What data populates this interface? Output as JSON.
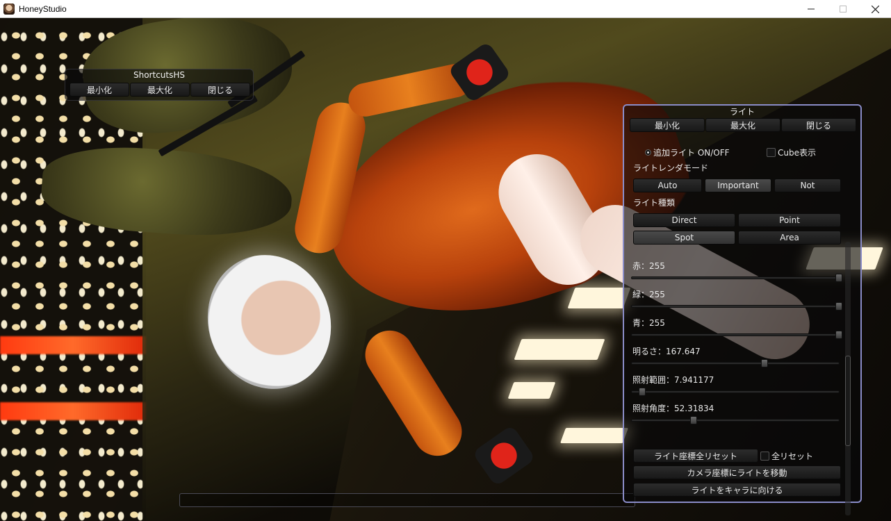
{
  "window": {
    "title": "HoneyStudio",
    "minimize_glyph": "—",
    "close_glyph": "✕"
  },
  "shortcuts_panel": {
    "title": "ShortcutsHS",
    "buttons": {
      "minimize": "最小化",
      "maximize": "最大化",
      "close": "閉じる"
    }
  },
  "light_panel": {
    "title": "ライト",
    "buttons": {
      "minimize": "最小化",
      "maximize": "最大化",
      "close": "閉じる"
    },
    "add_light_toggle": {
      "label": "追加ライト ON/OFF",
      "checked": true
    },
    "cube_toggle": {
      "label": "Cube表示",
      "checked": false
    },
    "render_mode": {
      "label": "ライトレンダモード",
      "options": [
        "Auto",
        "Important",
        "Not"
      ],
      "selected": "Important"
    },
    "light_type": {
      "label": "ライト種類",
      "options": [
        "Direct",
        "Point",
        "Spot",
        "Area"
      ],
      "selected": "Spot"
    },
    "sliders": {
      "red": {
        "label": "赤：255",
        "value": 255,
        "min": 0,
        "max": 255
      },
      "green": {
        "label": "緑：255",
        "value": 255,
        "min": 0,
        "max": 255
      },
      "blue": {
        "label": "青：255",
        "value": 255,
        "min": 0,
        "max": 255
      },
      "brightness": {
        "label": "明るさ：167.647",
        "value": 0.64
      },
      "range": {
        "label": "照射範囲：7.941177",
        "value": 0.05
      },
      "angle": {
        "label": "照射角度：52.31834",
        "value": 0.3
      }
    },
    "reset_position_button": "ライト座標全リセット",
    "reset_all_toggle": {
      "label": "全リセット",
      "checked": false
    },
    "move_to_camera_button": "カメラ座標にライトを移動",
    "face_character_button": "ライトをキャラに向ける",
    "scroll_position": 0.62
  },
  "colors": {
    "panel_border": "#8a8cc8",
    "selected_button": "#3a3a3a"
  }
}
